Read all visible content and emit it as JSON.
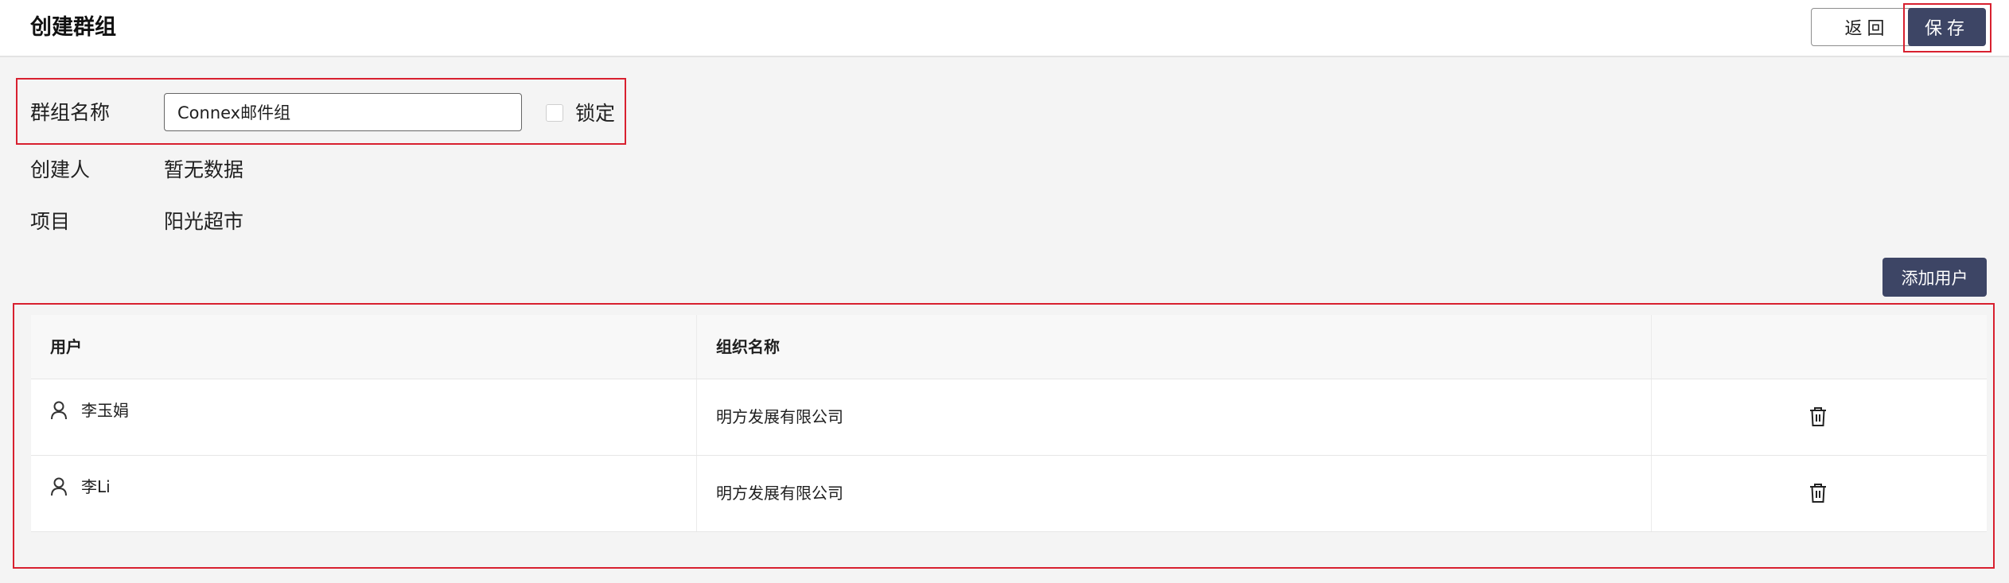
{
  "header": {
    "title": "创建群组",
    "back_label": "返回",
    "save_label": "保存"
  },
  "form": {
    "group_name_label": "群组名称",
    "group_name_value": "Connex邮件组",
    "lock_label": "锁定",
    "lock_checked": false,
    "creator_label": "创建人",
    "creator_value": "暂无数据",
    "project_label": "项目",
    "project_value": "阳光超市"
  },
  "users": {
    "add_button_label": "添加用户",
    "columns": [
      "用户",
      "组织名称",
      ""
    ],
    "rows": [
      {
        "user": "李玉娟",
        "org": "明方发展有限公司",
        "user_icon": "user-icon",
        "action_icon": "trash-icon"
      },
      {
        "user": "李Li",
        "org": "明方发展有限公司",
        "user_icon": "user-icon",
        "action_icon": "trash-icon"
      }
    ]
  },
  "colors": {
    "primary": "#3d4565",
    "highlight": "#d8202f",
    "background": "#f4f4f4"
  }
}
